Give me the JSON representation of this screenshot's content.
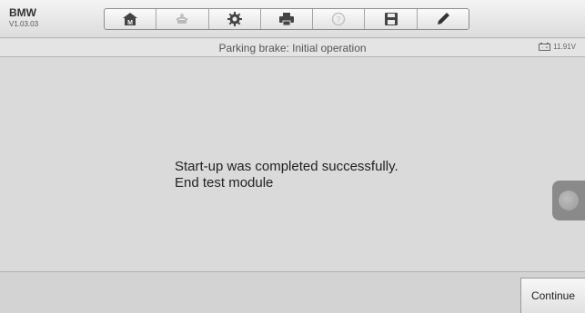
{
  "app": {
    "name": "BMW",
    "version": "V1.03.03"
  },
  "toolbar": {
    "items": [
      {
        "icon": "home-icon"
      },
      {
        "icon": "vehicle-swap-icon"
      },
      {
        "icon": "settings-gear-icon"
      },
      {
        "icon": "print-icon"
      },
      {
        "icon": "help-icon"
      },
      {
        "icon": "save-icon"
      },
      {
        "icon": "edit-pen-icon"
      }
    ]
  },
  "header": {
    "title": "Parking brake: Initial operation",
    "battery_voltage": "11.91V"
  },
  "message": {
    "line1": "Start-up was completed successfully.",
    "line2": "End test module"
  },
  "footer": {
    "continue_label": "Continue"
  },
  "colors": {
    "toolbar_bg": "#e9e9e9",
    "content_bg": "#dadada",
    "side_handle": "#8a8a8a"
  }
}
